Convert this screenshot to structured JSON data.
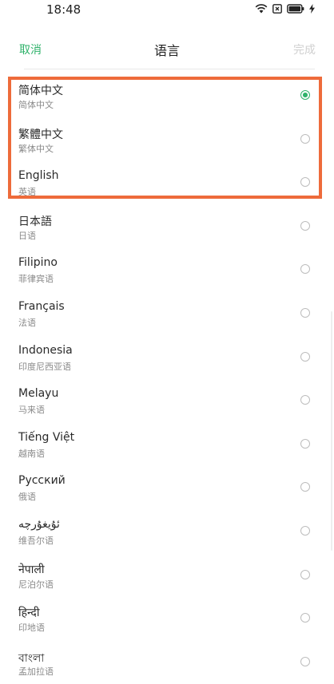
{
  "status_bar": {
    "time": "18:48",
    "icons": [
      "wifi-icon",
      "sim-icon",
      "battery-icon",
      "charging-icon"
    ]
  },
  "header": {
    "cancel_label": "取消",
    "title": "语言",
    "done_label": "完成"
  },
  "colors": {
    "accent": "#2fb26a",
    "highlight": "#ee6b3b",
    "disabled": "#d0d0d0"
  },
  "languages": [
    {
      "name": "简体中文",
      "sub": "简体中文",
      "selected": true
    },
    {
      "name": "繁體中文",
      "sub": "繁体中文",
      "selected": false
    },
    {
      "name": "English",
      "sub": "英语",
      "selected": false
    },
    {
      "name": "日本語",
      "sub": "日语",
      "selected": false
    },
    {
      "name": "Filipino",
      "sub": "菲律宾语",
      "selected": false
    },
    {
      "name": "Français",
      "sub": "法语",
      "selected": false
    },
    {
      "name": "Indonesia",
      "sub": "印度尼西亚语",
      "selected": false
    },
    {
      "name": "Melayu",
      "sub": "马来语",
      "selected": false
    },
    {
      "name": "Tiếng Việt",
      "sub": "越南语",
      "selected": false
    },
    {
      "name": "Русский",
      "sub": "俄语",
      "selected": false
    },
    {
      "name": "ئۇيغۇرچە",
      "sub": "维吾尔语",
      "selected": false
    },
    {
      "name": "नेपाली",
      "sub": "尼泊尔语",
      "selected": false
    },
    {
      "name": "हिन्दी",
      "sub": "印地语",
      "selected": false
    },
    {
      "name": "বাংলা",
      "sub": "孟加拉语",
      "selected": false
    }
  ]
}
